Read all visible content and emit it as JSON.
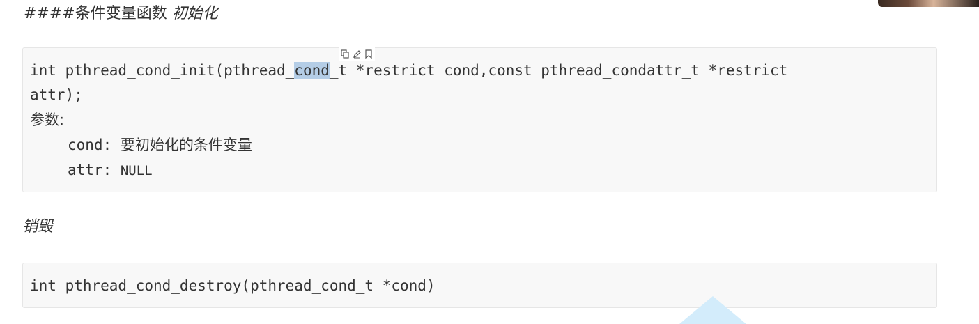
{
  "heading": {
    "prefix": "####条件变量函数 ",
    "italic": "初始化"
  },
  "init_block": {
    "line1_pre": "int pthread_cond_init(pthread_",
    "line1_sel": "cond",
    "line1_post": "_t *restrict cond,const pthread_condattr_t *restrict",
    "line2": "attr);",
    "params_label": "参数:",
    "param1_name": "cond: ",
    "param1_desc": "要初始化的条件变量",
    "param2_name": "attr: ",
    "param2_value": "NULL"
  },
  "destroy_title": "销毁",
  "destroy_block": {
    "line1": "int pthread_cond_destroy(pthread_cond_t *cond)"
  },
  "toolbar": {
    "icons": [
      "copy-icon",
      "edit-icon",
      "bookmark-icon"
    ]
  }
}
